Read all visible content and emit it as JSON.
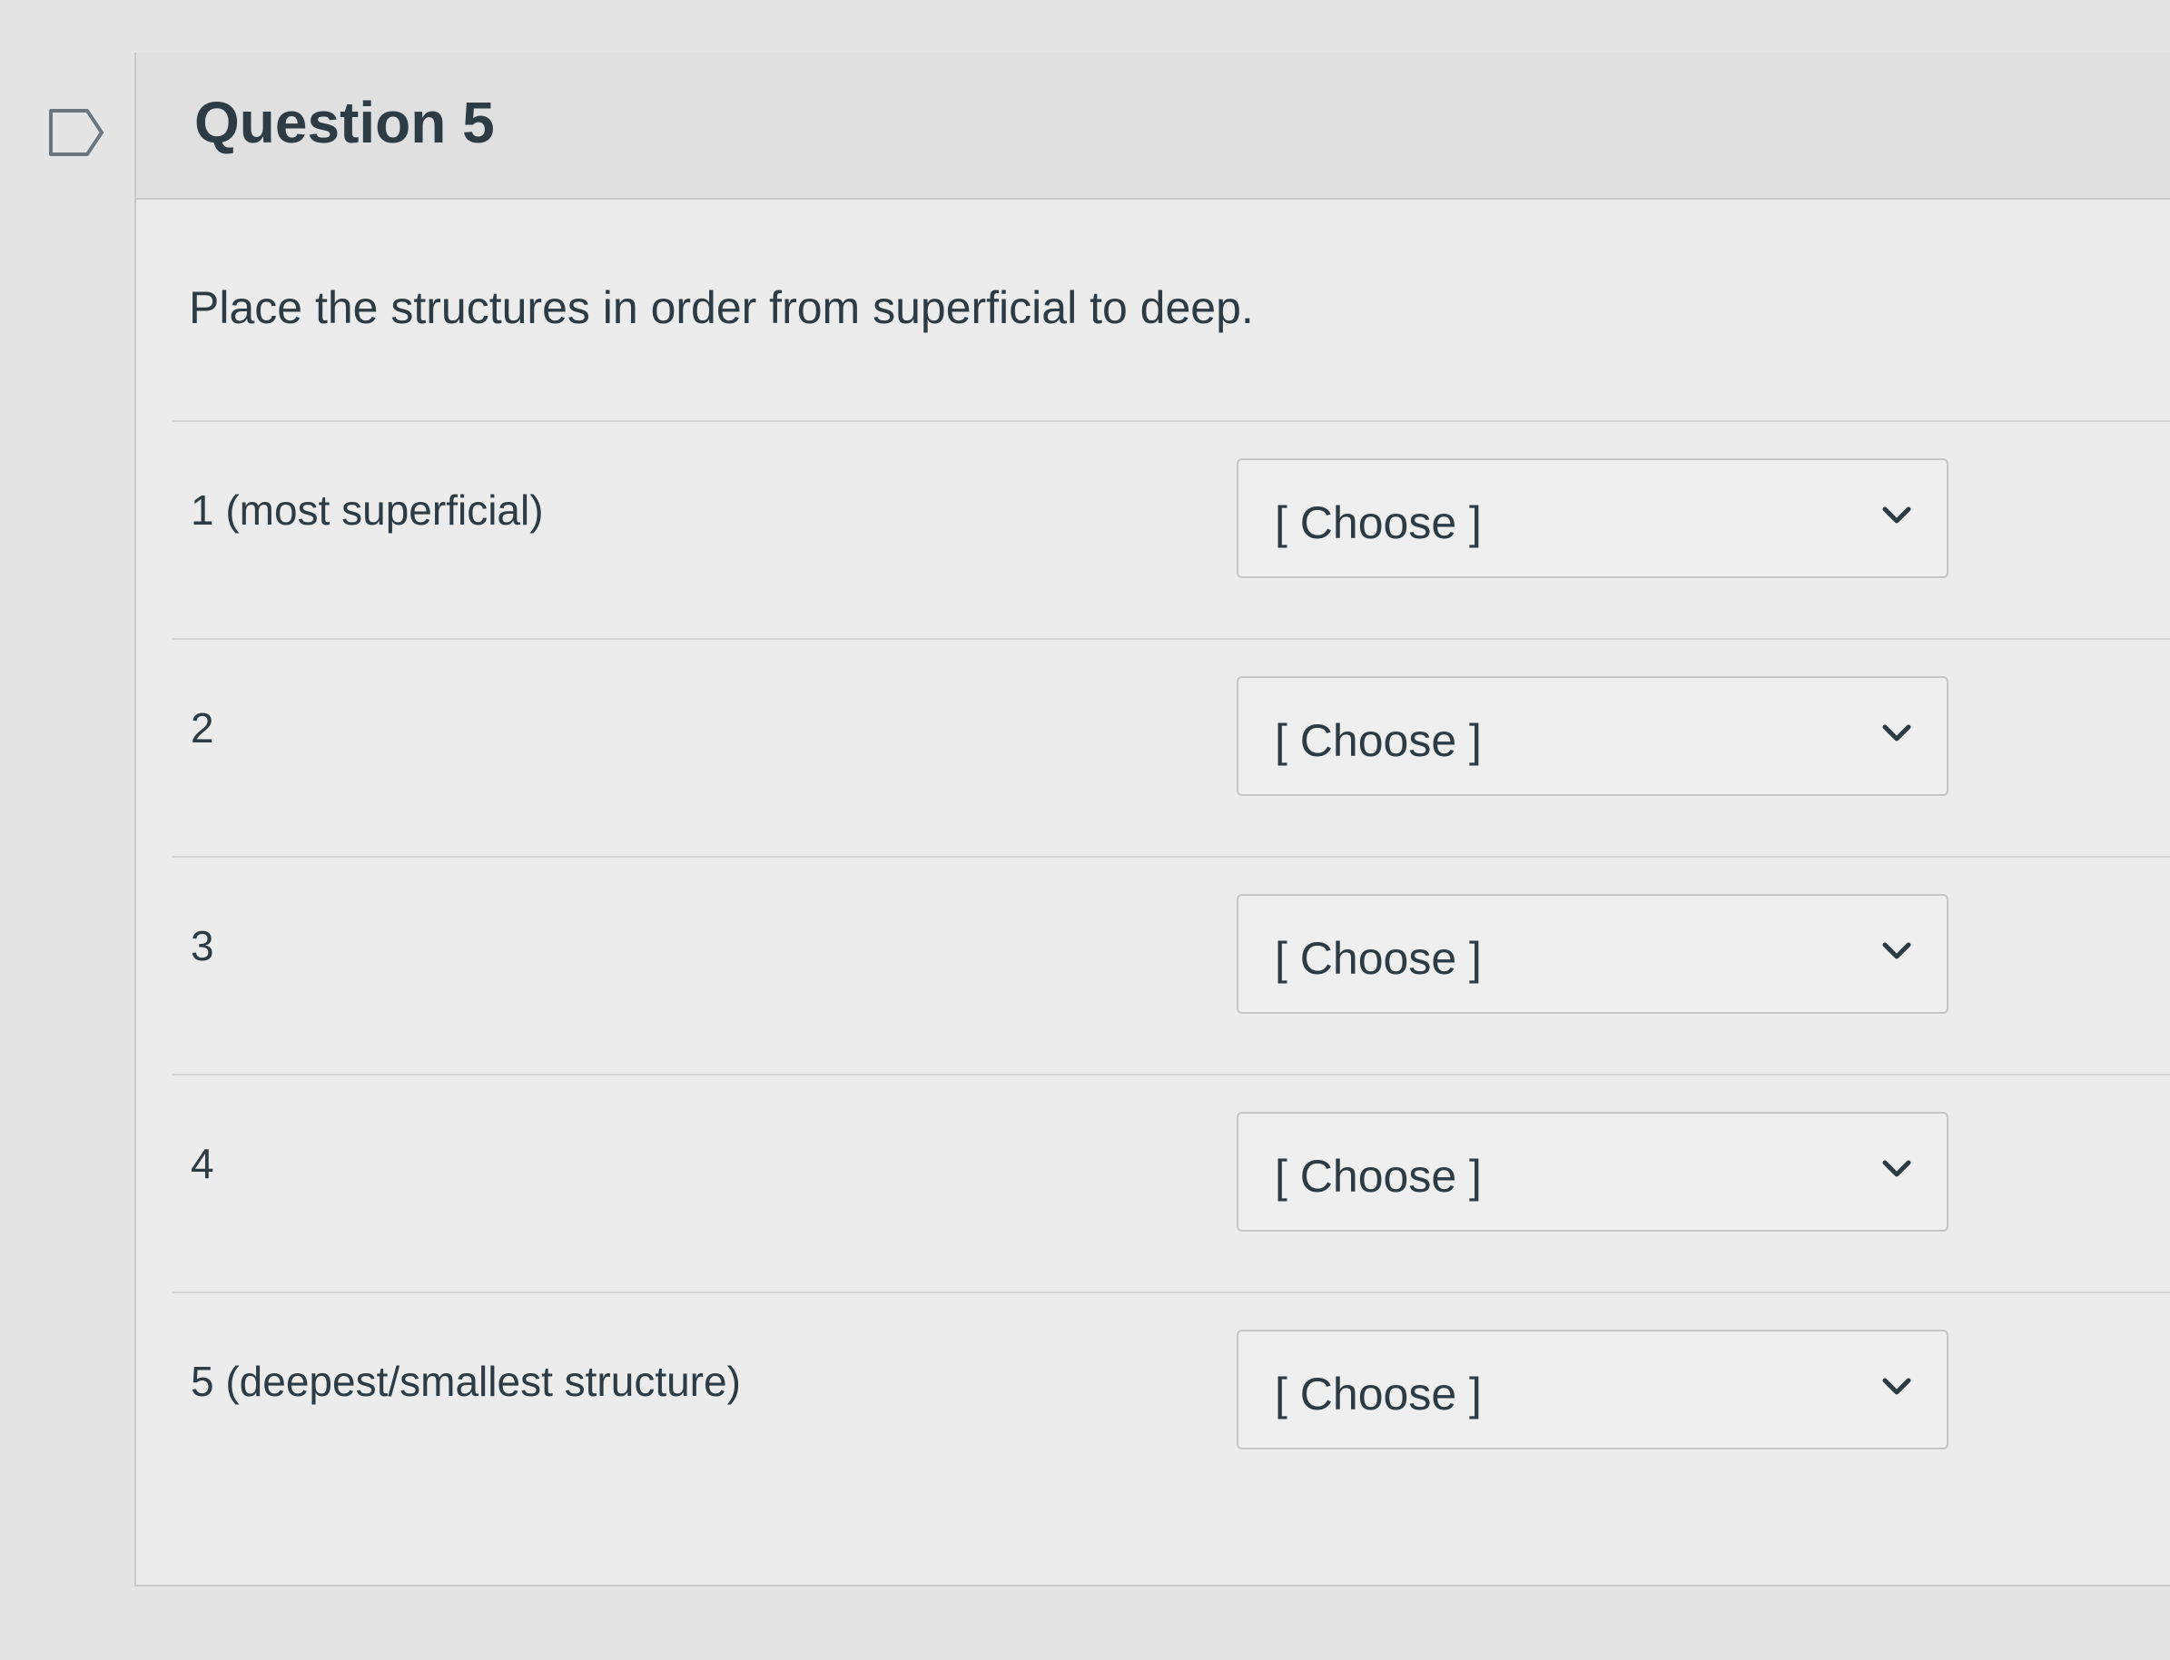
{
  "question": {
    "title": "Question 5",
    "prompt": "Place the structures in order from superficial to deep."
  },
  "rows": [
    {
      "label": "1 (most superficial)",
      "selected": "[ Choose ]"
    },
    {
      "label": "2",
      "selected": "[ Choose ]"
    },
    {
      "label": "3",
      "selected": "[ Choose ]"
    },
    {
      "label": "4",
      "selected": "[ Choose ]"
    },
    {
      "label": "5 (deepest/smallest structure)",
      "selected": "[ Choose ]"
    }
  ],
  "icons": {
    "flag": "flag-icon",
    "dropdown": "chevron-down-icon"
  },
  "colors": {
    "text": "#2d3b45",
    "border": "#c4c6c5",
    "background": "#e4e5e4"
  }
}
